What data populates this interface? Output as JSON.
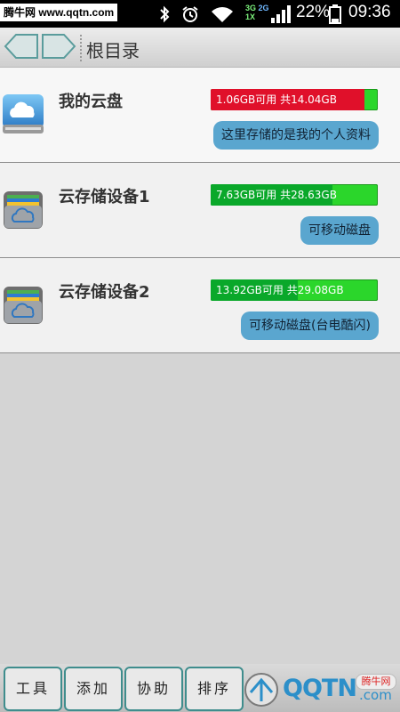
{
  "status_bar": {
    "watermark_text": "腾牛网 www.qqtn.com",
    "network_top": "3G",
    "network_bottom": "1X",
    "network_2g": "2G",
    "battery": "22%",
    "time": "09:36",
    "icons": [
      "bluetooth-icon",
      "alarm-icon",
      "wifi-icon",
      "signal-icon",
      "battery-icon"
    ]
  },
  "header": {
    "title": "根目录"
  },
  "items": [
    {
      "name": "我的云盘",
      "capacity": "1.06GB可用  共14.04GB",
      "capacity_used_fraction": 0.92,
      "capacity_color": "#e0102a",
      "description": "这里存储的是我的个人资料",
      "icon": "cloud-drive-icon"
    },
    {
      "name": "云存储设备1",
      "capacity": "7.63GB可用  共28.63GB",
      "capacity_used_fraction": 0.73,
      "capacity_color": "#0aa82a",
      "description": "可移动磁盘",
      "icon": "cloud-storage-icon"
    },
    {
      "name": "云存储设备2",
      "capacity": "13.92GB可用  共29.08GB",
      "capacity_used_fraction": 0.52,
      "capacity_color": "#0aa82a",
      "description": "可移动磁盘(台电酷闪)",
      "icon": "cloud-storage-icon"
    }
  ],
  "toolbar": {
    "buttons": [
      "工具",
      "添加",
      "协助",
      "排序"
    ]
  },
  "watermark": {
    "brand": "QQTN",
    "suffix": ".com",
    "badge": "腾牛网"
  },
  "colors": {
    "accent": "#3f8d8d",
    "pill": "#5aa6cf",
    "capacity_bg": "#2bd62b"
  }
}
